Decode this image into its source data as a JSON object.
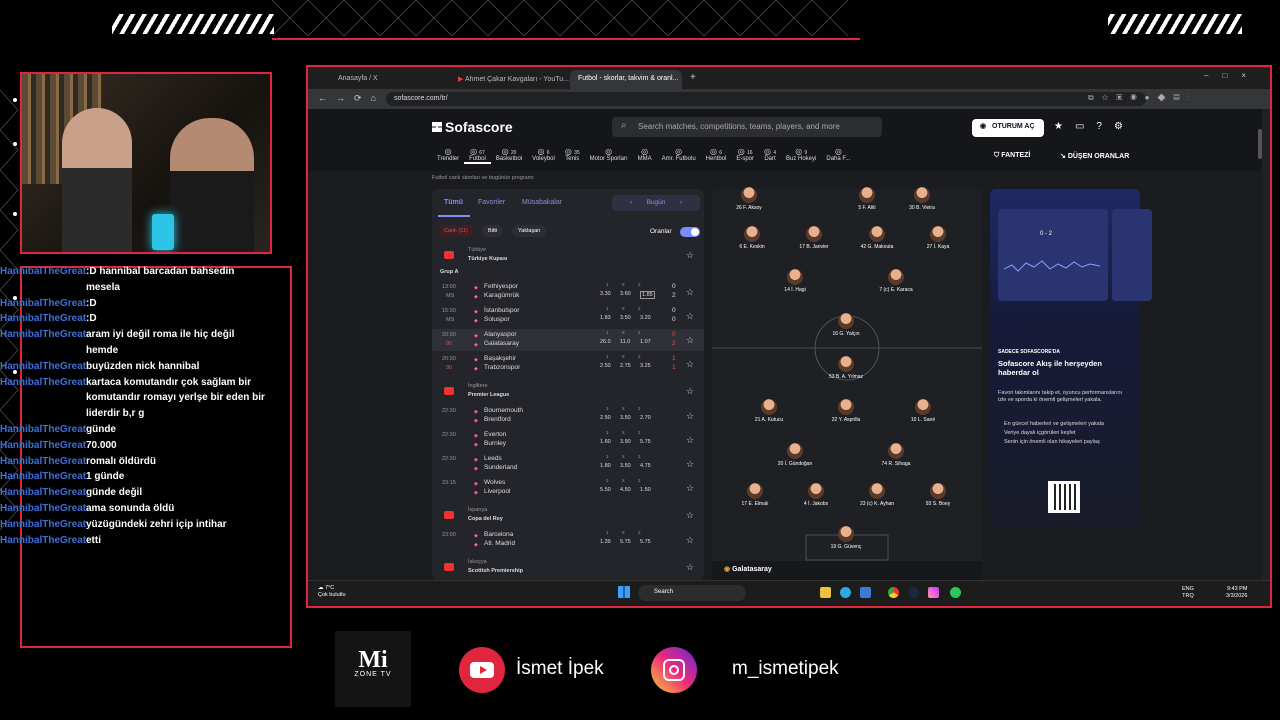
{
  "overlay": {
    "chat": [
      {
        "user": "HannibalTheGreat",
        "msg": ":D hannibal barcadan bahsedin mesela"
      },
      {
        "user": "HannibalTheGreat",
        "msg": ":D"
      },
      {
        "user": "HannibalTheGreat",
        "msg": ":D"
      },
      {
        "user": "HannibalTheGreat",
        "msg": "aram iyi değil roma ile hiç değil hemde"
      },
      {
        "user": "HannibalTheGreat",
        "msg": "buyüzden nick hannibal"
      },
      {
        "user": "HannibalTheGreat",
        "msg": "kartaca komutandır çok sağlam bir komutandır romayı yerlşe bir eden bir liderdir b,r g"
      },
      {
        "user": "HannibalTheGreat",
        "msg": "günde"
      },
      {
        "user": "HannibalTheGreat",
        "msg": "70.000"
      },
      {
        "user": "HannibalTheGreat",
        "msg": "romalı öldürdü"
      },
      {
        "user": "HannibalTheGreat",
        "msg": "1 günde"
      },
      {
        "user": "HannibalTheGreat",
        "msg": "günde değil"
      },
      {
        "user": "HannibalTheGreat",
        "msg": "ama sonunda öldü"
      },
      {
        "user": "HannibalTheGreat",
        "msg": "yüzügündeki zehri içip intihar"
      },
      {
        "user": "HannibalTheGreat",
        "msg": "etti"
      }
    ],
    "logo_text": "Mi",
    "logo_sub": "ZONE TV",
    "youtube_name": "İsmet İpek",
    "instagram_name": "m_ismetipek",
    "accent": "#e0263d"
  },
  "browser": {
    "tabs": [
      "Anasayfa / X",
      "Ahmet Çakar Kavgaları - YouTu...",
      "Futbol - skorlar, takvim & oranl..."
    ],
    "url": "sofascore.com/tr/"
  },
  "sofascore": {
    "logo": "Sofascore",
    "search_placeholder": "Search matches, competitions, teams, players, and more",
    "login": "OTURUM AÇ",
    "fantasy": "FANTEZİ",
    "odds": "DÜŞEN ORANLAR",
    "sports": [
      {
        "label": "Trendler",
        "count": ""
      },
      {
        "label": "Futbol",
        "count": "67"
      },
      {
        "label": "Basketbol",
        "count": "20"
      },
      {
        "label": "Voleybol",
        "count": "6"
      },
      {
        "label": "Tenis",
        "count": "35"
      },
      {
        "label": "Motor Sporları",
        "count": ""
      },
      {
        "label": "MMA",
        "count": ""
      },
      {
        "label": "Amr. Futbolu",
        "count": ""
      },
      {
        "label": "Hentbol",
        "count": "6"
      },
      {
        "label": "E-spor",
        "count": "16"
      },
      {
        "label": "Dart",
        "count": "4"
      },
      {
        "label": "Buz Hokeyi",
        "count": "9"
      },
      {
        "label": "Daha F...",
        "count": ""
      }
    ],
    "subtitle": "Futbol canlı skorları ve bugünün programı",
    "list_tabs": [
      "Tümü",
      "Favoriler",
      "Müsabakalar"
    ],
    "date_label": "Bugün",
    "filters": [
      "Canlı (11)",
      "Bitti",
      "Yaklaşan"
    ],
    "odds_toggle": "Oranlar",
    "leagues": [
      {
        "country": "Türkiye",
        "name": "Türkiye Kupası",
        "group": "Grup A",
        "matches": [
          {
            "time": "13:00",
            "status": "MS",
            "home": "Fethiyespor",
            "away": "Karagümrük",
            "o1": "3.30",
            "ox": "3.60",
            "o2": "1.85",
            "hs": "0",
            "as": "2"
          },
          {
            "time": "15:30",
            "status": "MS",
            "home": "İstanbulspor",
            "away": "Soluspor",
            "o1": "1.83",
            "ox": "3.50",
            "o2": "3.20",
            "hs": "0",
            "as": "0"
          },
          {
            "time": "20:30",
            "status": "90",
            "home": "Alanyaspor",
            "away": "Galatasaray",
            "o1": "26.0",
            "ox": "11.0",
            "o2": "1.07",
            "hs": "0",
            "as": "2"
          },
          {
            "time": "20:30",
            "status": "90",
            "home": "Başakşehir",
            "away": "Trabzonspor",
            "o1": "2.50",
            "ox": "2.75",
            "o2": "3.25",
            "hs": "1",
            "as": "1"
          }
        ]
      },
      {
        "country": "İngiltere",
        "name": "Premier League",
        "group": "",
        "matches": [
          {
            "time": "22:30",
            "status": "",
            "home": "Bournemouth",
            "away": "Brentford",
            "o1": "2.50",
            "ox": "3.50",
            "o2": "2.70",
            "hs": "",
            "as": ""
          },
          {
            "time": "22:30",
            "status": "",
            "home": "Everton",
            "away": "Burnley",
            "o1": "1.60",
            "ox": "3.90",
            "o2": "5.75",
            "hs": "",
            "as": ""
          },
          {
            "time": "22:30",
            "status": "",
            "home": "Leeds",
            "away": "Sunderland",
            "o1": "1.80",
            "ox": "3.50",
            "o2": "4.75",
            "hs": "",
            "as": ""
          },
          {
            "time": "23:15",
            "status": "",
            "home": "Wolves",
            "away": "Liverpool",
            "o1": "5.50",
            "ox": "4.50",
            "o2": "1.50",
            "hs": "",
            "as": ""
          }
        ]
      },
      {
        "country": "İspanya",
        "name": "Copa del Rey",
        "group": "",
        "matches": [
          {
            "time": "23:00",
            "status": "",
            "home": "Barcelona",
            "away": "Atl. Madrid",
            "o1": "1.39",
            "ox": "5.75",
            "o2": "5.75",
            "hs": "",
            "as": ""
          }
        ]
      },
      {
        "country": "İskoçya",
        "name": "Scottish Premiership",
        "group": "",
        "matches": []
      }
    ],
    "lineup": {
      "team": "Galatasaray",
      "players": [
        "26 F. Aksoy",
        "5 F. Aliti",
        "30 B. Vieira",
        "6 E. Keskin",
        "17 B. Janvier",
        "42 G. Makouta",
        "27 İ. Kaya",
        "14 İ. Hagi",
        "7 (c) E. Karaca",
        "16 G. Yalçın",
        "53 B. A. Yılmaz",
        "21 A. Kutucu",
        "22 Y. Asprilla",
        "10 L. Sané",
        "20 İ. Gündoğan",
        "74 R. Sihaga",
        "17 E. Elmalı",
        "4 İ. Jakobs",
        "23 (c) K. Ayhan",
        "93 S. Boey",
        "19 G. Güvenç"
      ]
    },
    "promo": {
      "eyebrow": "SADECE SOFASCORE'DA",
      "title": "Sofascore Akış ile herşeyden haberdar ol",
      "body": "Favori takımlarını takip et, oyuncu performanslarını izle ve sporda ki önemli gelişmeleri yakala.",
      "bullets": [
        "En güncel haberleri ve gelişmeleri yakala",
        "Veriye dayalı içgörüleri keşfet",
        "Senin için önemli olan hikayeleri paylaş"
      ],
      "score": "0 - 2"
    }
  },
  "taskbar": {
    "weather_temp": "7°C",
    "weather_desc": "Çok bulutlu",
    "search": "Search",
    "lang": "ENG",
    "lang2": "TRQ",
    "time": "9:43 PM",
    "date": "3/3/2026"
  }
}
